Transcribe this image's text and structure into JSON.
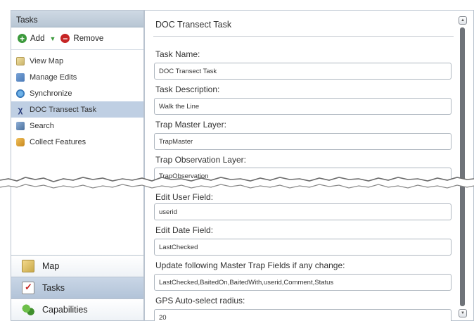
{
  "sidebar": {
    "header": "Tasks",
    "toolbar": {
      "add": "Add",
      "remove": "Remove"
    },
    "items": [
      {
        "label": "View Map",
        "icon": "map-icon"
      },
      {
        "label": "Manage Edits",
        "icon": "edit-icon"
      },
      {
        "label": "Synchronize",
        "icon": "sync-icon"
      },
      {
        "label": "DOC Transect Task",
        "icon": "transect-icon",
        "selected": true
      },
      {
        "label": "Search",
        "icon": "search-icon"
      },
      {
        "label": "Collect Features",
        "icon": "collect-icon"
      }
    ],
    "nav": [
      {
        "label": "Map",
        "icon": "map-icon"
      },
      {
        "label": "Tasks",
        "icon": "tasks-icon",
        "active": true
      },
      {
        "label": "Capabilities",
        "icon": "capabilities-icon"
      }
    ]
  },
  "form": {
    "title": "DOC Transect Task",
    "fields": [
      {
        "label": "Task Name:",
        "value": "DOC Transect Task"
      },
      {
        "label": "Task Description:",
        "value": "Walk the Line"
      },
      {
        "label": "Trap Master Layer:",
        "value": "TrapMaster"
      },
      {
        "label": "Trap Observation Layer:",
        "value": "TrapObservation"
      },
      {
        "label": "Edit User Field:",
        "value": "userid"
      },
      {
        "label": "Edit Date Field:",
        "value": "LastChecked"
      },
      {
        "label": "Update following Master Trap Fields if any change:",
        "value": "LastChecked,BaitedOn,BaitedWith,userid,Comment,Status"
      },
      {
        "label": "GPS Auto-select radius:",
        "value": "20"
      }
    ]
  },
  "colors": {
    "selection": "#bfcfe3",
    "header": "#c4d1de",
    "add_green": "#3d9a3d",
    "remove_red": "#c62525"
  }
}
